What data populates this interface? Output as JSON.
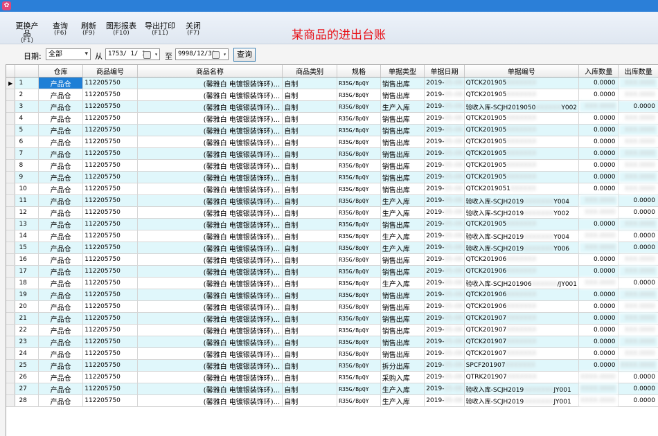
{
  "toolbar": {
    "buttons": [
      {
        "label": "更换产品",
        "key": "(F1)"
      },
      {
        "label": "查询",
        "key": "(F6)"
      },
      {
        "label": "刷新",
        "key": "(F9)"
      },
      {
        "label": "图形报表",
        "key": "(F10)"
      },
      {
        "label": "导出打印",
        "key": "(F11)"
      },
      {
        "label": "关闭",
        "key": "(F7)"
      }
    ],
    "title": "某商品的进出台账"
  },
  "filter": {
    "date_label": "日期:",
    "period_value": "全部",
    "from_label": "从",
    "from_date": "1753/ 1/ 1",
    "to_label": "至",
    "to_date": "9998/12/31",
    "query_label": "查询"
  },
  "columns": [
    "",
    "仓库",
    "商品编号",
    "商品名称",
    "商品类别",
    "规格",
    "单据类型",
    "单据日期",
    "单据编号",
    "入库数量",
    "出库数量"
  ],
  "rows": [
    {
      "no": "1",
      "wh": "产品仓",
      "code": "112205750",
      "name": "(馨雅白 电镀银装饰环)...",
      "cat": "自制",
      "spec": "R35G/BpQY",
      "type": "销售出库",
      "date": "2019-",
      "docno": "QTCK201905",
      "docno_hidden": "XXXXXXX",
      "in": "0.0000",
      "out": "XXX.0000",
      "out_blur": true
    },
    {
      "no": "2",
      "wh": "产品仓",
      "code": "112205750",
      "name": "(馨雅白 电镀银装饰环)...",
      "cat": "自制",
      "spec": "R35G/BpQY",
      "type": "销售出库",
      "date": "2019-",
      "docno": "QTCK201905",
      "docno_hidden": "XXXXXXX",
      "in": "0.0000",
      "out": "XXX.0000",
      "out_blur": true
    },
    {
      "no": "3",
      "wh": "产品仓",
      "code": "112205750",
      "name": "(馨雅白 电镀银装饰环)...",
      "cat": "自制",
      "spec": "R35G/BpQY",
      "type": "生产入库",
      "date": "2019-",
      "docno": "验收入库-SCJH2019050",
      "docno_hidden": "XXXXXX",
      "docno_tail": "Y002",
      "in": "XXX.0000",
      "out": "0.0000",
      "in_blur": true
    },
    {
      "no": "4",
      "wh": "产品仓",
      "code": "112205750",
      "name": "(馨雅白 电镀银装饰环)...",
      "cat": "自制",
      "spec": "R35G/BpQY",
      "type": "销售出库",
      "date": "2019-",
      "docno": "QTCK201905",
      "docno_hidden": "XXXXXXX",
      "in": "0.0000",
      "out": "XXX.0000",
      "out_blur": true
    },
    {
      "no": "5",
      "wh": "产品仓",
      "code": "112205750",
      "name": "(馨雅白 电镀银装饰环)...",
      "cat": "自制",
      "spec": "R35G/BpQY",
      "type": "销售出库",
      "date": "2019-",
      "docno": "QTCK201905",
      "docno_hidden": "XXXXXXX",
      "in": "0.0000",
      "out": "XXX.0000",
      "out_blur": true
    },
    {
      "no": "6",
      "wh": "产品仓",
      "code": "112205750",
      "name": "(馨雅白 电镀银装饰环)...",
      "cat": "自制",
      "spec": "R35G/BpQY",
      "type": "销售出库",
      "date": "2019-",
      "docno": "QTCK201905",
      "docno_hidden": "XXXXXXX",
      "in": "0.0000",
      "out": "XXX.0000",
      "out_blur": true
    },
    {
      "no": "7",
      "wh": "产品仓",
      "code": "112205750",
      "name": "(馨雅白 电镀银装饰环)...",
      "cat": "自制",
      "spec": "R35G/BpQY",
      "type": "销售出库",
      "date": "2019-",
      "docno": "QTCK201905",
      "docno_hidden": "XXXXXXX",
      "in": "0.0000",
      "out": "XXX.0000",
      "out_blur": true
    },
    {
      "no": "8",
      "wh": "产品仓",
      "code": "112205750",
      "name": "(馨雅白 电镀银装饰环)...",
      "cat": "自制",
      "spec": "R35G/BpQY",
      "type": "销售出库",
      "date": "2019-",
      "docno": "QTCK201905",
      "docno_hidden": "XXXXXXX",
      "in": "0.0000",
      "out": "XXX.0000",
      "out_blur": true
    },
    {
      "no": "9",
      "wh": "产品仓",
      "code": "112205750",
      "name": "(馨雅白 电镀银装饰环)...",
      "cat": "自制",
      "spec": "R35G/BpQY",
      "type": "销售出库",
      "date": "2019-",
      "docno": "QTCK201905",
      "docno_hidden": "XXXXXXX",
      "in": "0.0000",
      "out": "XXX.0000",
      "out_blur": true
    },
    {
      "no": "10",
      "wh": "产品仓",
      "code": "112205750",
      "name": "(馨雅白 电镀银装饰环)...",
      "cat": "自制",
      "spec": "R35G/BpQY",
      "type": "销售出库",
      "date": "2019-",
      "docno": "QTCK2019051",
      "docno_hidden": "XXXXXX",
      "in": "0.0000",
      "out": "XXX.0000",
      "out_blur": true
    },
    {
      "no": "11",
      "wh": "产品仓",
      "code": "112205750",
      "name": "(馨雅白 电镀银装饰环)...",
      "cat": "自制",
      "spec": "R35G/BpQY",
      "type": "生产入库",
      "date": "2019-",
      "docno": "验收入库-SCJH2019",
      "docno_hidden": "XXXXXXX",
      "docno_tail": "Y004",
      "in": "XXX.0000",
      "out": "0.0000",
      "in_blur": true
    },
    {
      "no": "12",
      "wh": "产品仓",
      "code": "112205750",
      "name": "(馨雅白 电镀银装饰环)...",
      "cat": "自制",
      "spec": "R35G/BpQY",
      "type": "生产入库",
      "date": "2019-",
      "docno": "验收入库-SCJH2019",
      "docno_hidden": "XXXXXXX",
      "docno_tail": "Y002",
      "in": "XXX.0000",
      "out": "0.0000",
      "in_blur": true
    },
    {
      "no": "13",
      "wh": "产品仓",
      "code": "112205750",
      "name": "(馨雅白 电镀银装饰环)...",
      "cat": "自制",
      "spec": "R35G/BpQY",
      "type": "销售出库",
      "date": "2019-",
      "docno": "QTCK201905",
      "docno_hidden": "XXXXXXX",
      "in": "0.0000",
      "out": "XXX.0000",
      "out_blur": true
    },
    {
      "no": "14",
      "wh": "产品仓",
      "code": "112205750",
      "name": "(馨雅白 电镀银装饰环)...",
      "cat": "自制",
      "spec": "R35G/BpQY",
      "type": "生产入库",
      "date": "2019-",
      "docno": "验收入库-SCJH2019",
      "docno_hidden": "XXXXXXX",
      "docno_tail": "Y004",
      "in": "XXX.0000",
      "out": "0.0000",
      "in_blur": true
    },
    {
      "no": "15",
      "wh": "产品仓",
      "code": "112205750",
      "name": "(馨雅白 电镀银装饰环)...",
      "cat": "自制",
      "spec": "R35G/BpQY",
      "type": "生产入库",
      "date": "2019-",
      "docno": "验收入库-SCJH2019",
      "docno_hidden": "XXXXXXX",
      "docno_tail": "Y006",
      "in": "XXX.0000",
      "out": "0.0000",
      "in_blur": true
    },
    {
      "no": "16",
      "wh": "产品仓",
      "code": "112205750",
      "name": "(馨雅白 电镀银装饰环)...",
      "cat": "自制",
      "spec": "R35G/BpQY",
      "type": "销售出库",
      "date": "2019-",
      "docno": "QTCK201906",
      "docno_hidden": "XXXXXXX",
      "in": "0.0000",
      "out": "XXX.0000",
      "out_blur": true
    },
    {
      "no": "17",
      "wh": "产品仓",
      "code": "112205750",
      "name": "(馨雅白 电镀银装饰环)...",
      "cat": "自制",
      "spec": "R35G/BpQY",
      "type": "销售出库",
      "date": "2019-",
      "docno": "QTCK201906",
      "docno_hidden": "XXXXXXX",
      "in": "0.0000",
      "out": "XXX.0000",
      "out_blur": true
    },
    {
      "no": "18",
      "wh": "产品仓",
      "code": "112205750",
      "name": "(馨雅白 电镀银装饰环)...",
      "cat": "自制",
      "spec": "R35G/BpQY",
      "type": "生产入库",
      "date": "2019-",
      "docno": "验收入库-SCJH201906",
      "docno_hidden": "XXXXXX",
      "docno_tail": "/JY001",
      "in": "XXX.0000",
      "out": "0.0000",
      "in_blur": true
    },
    {
      "no": "19",
      "wh": "产品仓",
      "code": "112205750",
      "name": "(馨雅白 电镀银装饰环)...",
      "cat": "自制",
      "spec": "R35G/BpQY",
      "type": "销售出库",
      "date": "2019-",
      "docno": "QTCK201906",
      "docno_hidden": "XXXXXXX",
      "in": "0.0000",
      "out": "XXX.0000",
      "out_blur": true
    },
    {
      "no": "20",
      "wh": "产品仓",
      "code": "112205750",
      "name": "(馨雅白 电镀银装饰环)...",
      "cat": "自制",
      "spec": "R35G/BpQY",
      "type": "销售出库",
      "date": "2019-",
      "docno": "QTCK201906",
      "docno_hidden": "XXXXXXX",
      "in": "0.0000",
      "out": "XXX.0000",
      "out_blur": true
    },
    {
      "no": "21",
      "wh": "产品仓",
      "code": "112205750",
      "name": "(馨雅白 电镀银装饰环)...",
      "cat": "自制",
      "spec": "R35G/BpQY",
      "type": "销售出库",
      "date": "2019-",
      "docno": "QTCK201907",
      "docno_hidden": "XXXXXXX",
      "in": "0.0000",
      "out": "XXX.0000",
      "out_blur": true
    },
    {
      "no": "22",
      "wh": "产品仓",
      "code": "112205750",
      "name": "(馨雅白 电镀银装饰环)...",
      "cat": "自制",
      "spec": "R35G/BpQY",
      "type": "销售出库",
      "date": "2019-",
      "docno": "QTCK201907",
      "docno_hidden": "XXXXXXX",
      "in": "0.0000",
      "out": "XXX.0000",
      "out_blur": true
    },
    {
      "no": "23",
      "wh": "产品仓",
      "code": "112205750",
      "name": "(馨雅白 电镀银装饰环)...",
      "cat": "自制",
      "spec": "R35G/BpQY",
      "type": "销售出库",
      "date": "2019-",
      "docno": "QTCK201907",
      "docno_hidden": "XXXXXXX",
      "in": "0.0000",
      "out": "XXX.0000",
      "out_blur": true
    },
    {
      "no": "24",
      "wh": "产品仓",
      "code": "112205750",
      "name": "(馨雅白 电镀银装饰环)...",
      "cat": "自制",
      "spec": "R35G/BpQY",
      "type": "销售出库",
      "date": "2019-",
      "docno": "QTCK201907",
      "docno_hidden": "XXXXXXX",
      "in": "0.0000",
      "out": "XXX.0000",
      "out_blur": true
    },
    {
      "no": "25",
      "wh": "产品仓",
      "code": "112205750",
      "name": "(馨雅白 电镀银装饰环)...",
      "cat": "自制",
      "spec": "R35G/BpQY",
      "type": "拆分出库",
      "date": "2019-",
      "docno": "SPCF201907",
      "docno_hidden": "XXXXXXX",
      "in": "0.0000",
      "out": "XXXX.0000",
      "out_blur": true
    },
    {
      "no": "26",
      "wh": "产品仓",
      "code": "112205750",
      "name": "(馨雅白 电镀银装饰环)...",
      "cat": "自制",
      "spec": "R35G/BpQY",
      "type": "采购入库",
      "date": "2019-",
      "docno": "QTRK201907",
      "docno_hidden": "XXXXXXX",
      "in": "XXXX.0000",
      "out": "0.0000",
      "in_blur": true
    },
    {
      "no": "27",
      "wh": "产品仓",
      "code": "112205750",
      "name": "(馨雅白 电镀银装饰环)...",
      "cat": "自制",
      "spec": "R35G/BpQY",
      "type": "生产入库",
      "date": "2019-",
      "docno": "验收入库-SCJH2019",
      "docno_hidden": "XXXXXXX",
      "docno_tail": "JY001",
      "in": "XXXX.0000",
      "out": "0.0000",
      "in_blur": true
    },
    {
      "no": "28",
      "wh": "产品仓",
      "code": "112205750",
      "name": "(馨雅白 电镀银装饰环)...",
      "cat": "自制",
      "spec": "R35G/BpQY",
      "type": "生产入库",
      "date": "2019-",
      "docno": "验收入库-SCJH2019",
      "docno_hidden": "XXXXXXX",
      "docno_tail": "JY001",
      "in": "XXXX.0000",
      "out": "0.0000",
      "in_blur": true
    }
  ],
  "selected_row": 0,
  "colors": {
    "accent": "#1e7fd6",
    "title": "#e8141b",
    "row_alt": "#e0f7fb",
    "titlebar": "#2b7fd8"
  }
}
